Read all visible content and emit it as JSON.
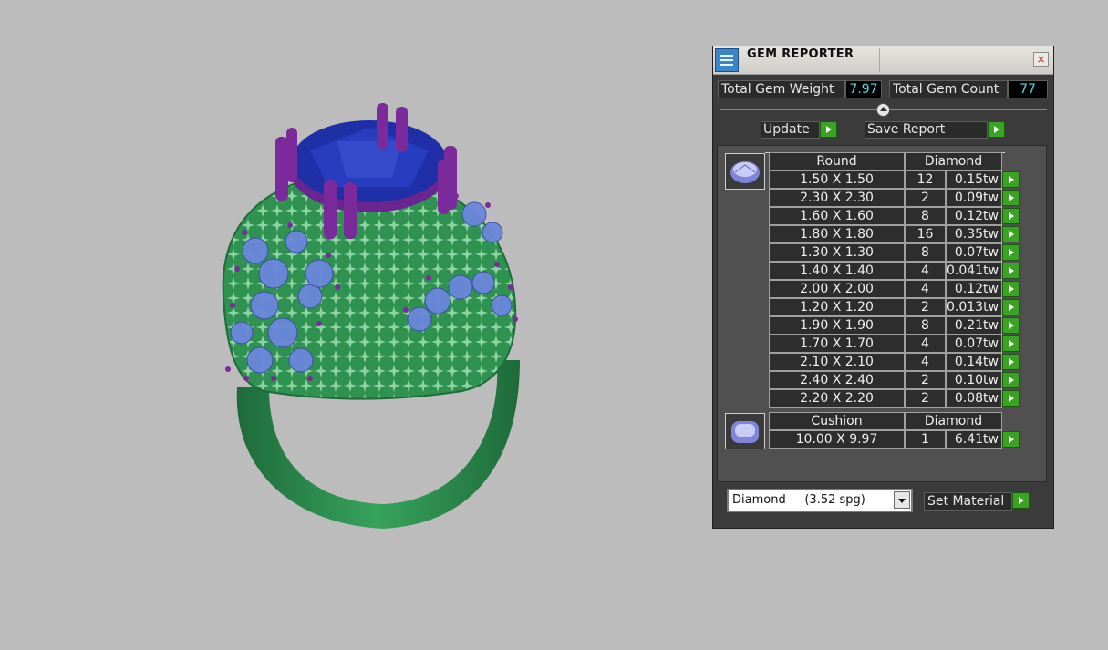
{
  "panel": {
    "title": "GEM REPORTER",
    "close_symbol": "×",
    "total_gem_weight_label": "Total Gem Weight",
    "total_gem_weight_value": "7.97",
    "total_gem_count_label": "Total Gem Count",
    "total_gem_count_value": "77",
    "update_label": "Update",
    "save_report_label": "Save Report",
    "material_select_value": "Diamond     (3.52 spg)",
    "set_material_label": "Set Material",
    "icons": {
      "app": "gem-reporter-icon",
      "close": "close-icon",
      "play": "green-play-arrow-icon",
      "dropdown": "chevron-down-icon",
      "slider": "slider-thumb-icon"
    }
  },
  "groups": [
    {
      "shape": "Round",
      "material": "Diamond",
      "thumb_icon": "round-gem-icon",
      "rows": [
        {
          "size": "1.50 X 1.50",
          "count": "12",
          "weight": "0.15tw"
        },
        {
          "size": "2.30 X 2.30",
          "count": "2",
          "weight": "0.09tw"
        },
        {
          "size": "1.60 X 1.60",
          "count": "8",
          "weight": "0.12tw"
        },
        {
          "size": "1.80 X 1.80",
          "count": "16",
          "weight": "0.35tw"
        },
        {
          "size": "1.30 X 1.30",
          "count": "8",
          "weight": "0.07tw"
        },
        {
          "size": "1.40 X 1.40",
          "count": "4",
          "weight": "0.041tw"
        },
        {
          "size": "2.00 X 2.00",
          "count": "4",
          "weight": "0.12tw"
        },
        {
          "size": "1.20 X 1.20",
          "count": "2",
          "weight": "0.013tw"
        },
        {
          "size": "1.90 X 1.90",
          "count": "8",
          "weight": "0.21tw"
        },
        {
          "size": "1.70 X 1.70",
          "count": "4",
          "weight": "0.07tw"
        },
        {
          "size": "2.10 X 2.10",
          "count": "4",
          "weight": "0.14tw"
        },
        {
          "size": "2.40 X 2.40",
          "count": "2",
          "weight": "0.10tw"
        },
        {
          "size": "2.20 X 2.20",
          "count": "2",
          "weight": "0.08tw"
        }
      ]
    },
    {
      "shape": "Cushion",
      "material": "Diamond",
      "thumb_icon": "cushion-gem-icon",
      "rows": [
        {
          "size": "10.00 X 9.97",
          "count": "1",
          "weight": "6.41tw"
        }
      ]
    }
  ],
  "colors": {
    "background": "#bdbcbc",
    "panel": "#3b3b3b",
    "value_text": "#4fd8e6",
    "button_green": "#3aa323",
    "ring_metal": "#2e8a4e",
    "center_stone": "#1f2fa8",
    "prongs": "#7a2a9a",
    "side_stones": "#6b86dc"
  }
}
